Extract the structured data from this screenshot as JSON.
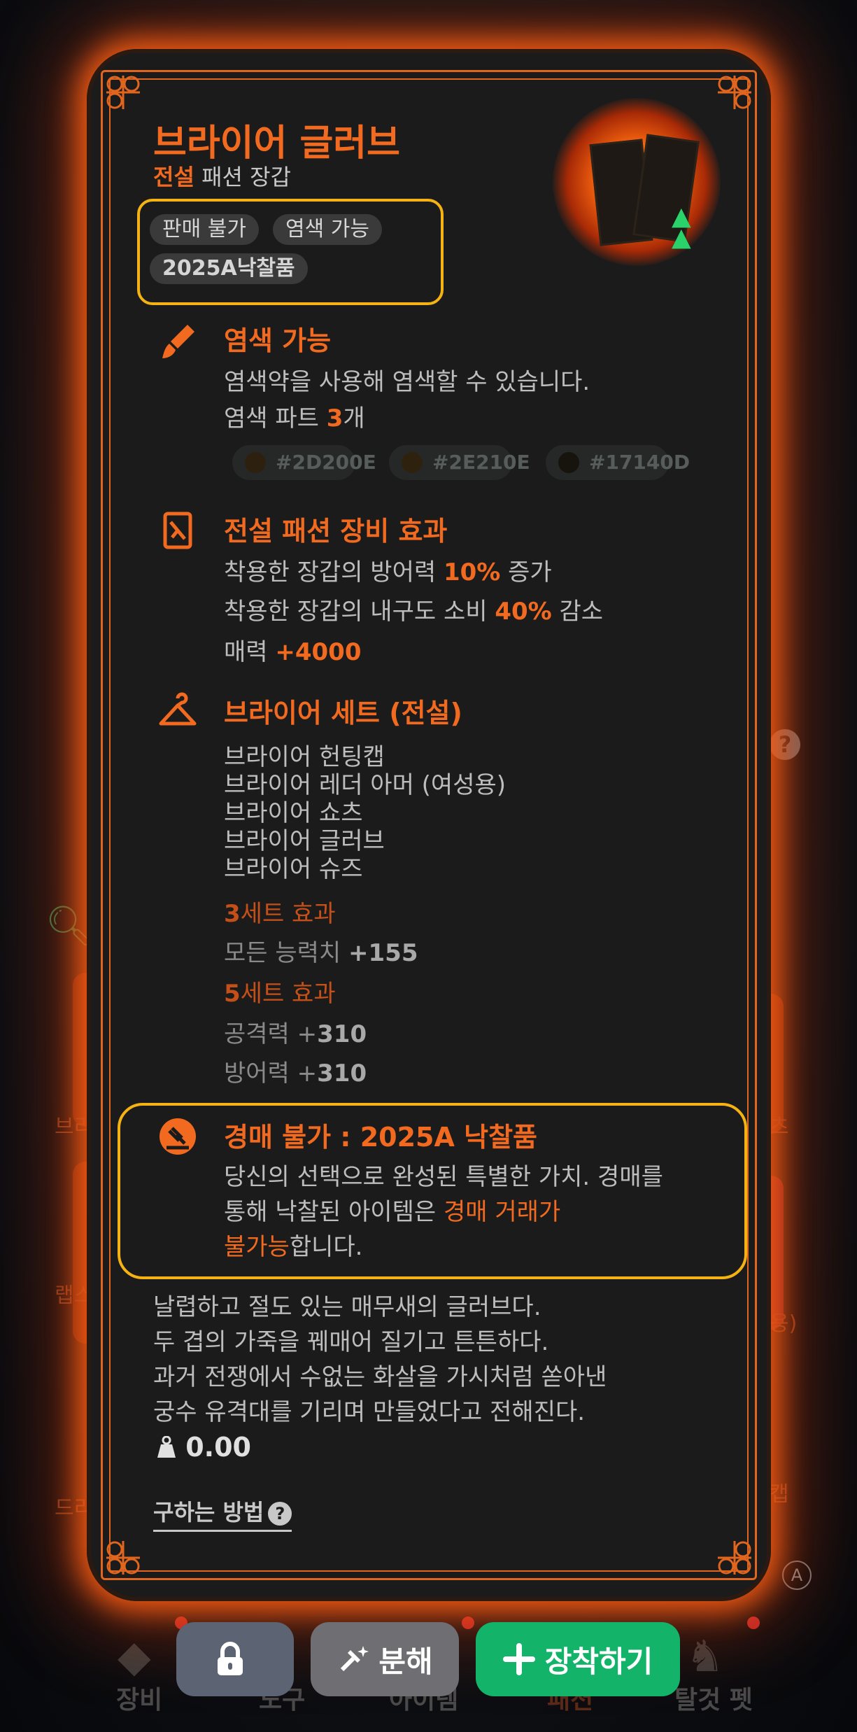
{
  "item": {
    "name": "브라이어 글러브",
    "grade": "전설",
    "category": "패션 장갑",
    "tags": [
      "판매 불가",
      "염색 가능",
      "2025A낙찰품"
    ]
  },
  "dye": {
    "title": "염색 가능",
    "desc": "염색약을 사용해 염색할 수 있습니다.",
    "parts_prefix": "염색 파트 ",
    "parts_count": "3",
    "parts_suffix": "개",
    "colors": [
      {
        "label": "#2D200E",
        "color": "#2D200E"
      },
      {
        "label": "#2E210E",
        "color": "#2E210E"
      },
      {
        "label": "#17140D",
        "color": "#17140D"
      }
    ]
  },
  "effects": {
    "title": "전설 패션 장비 효과",
    "l1_pre": "착용한 장갑의 방어력 ",
    "l1_val": "10%",
    "l1_post": " 증가",
    "l2_pre": "착용한 장갑의 내구도 소비 ",
    "l2_val": "40%",
    "l2_post": " 감소",
    "l3_pre": "매력 ",
    "l3_val": "+4000"
  },
  "set": {
    "title": "브라이어 세트 (전설)",
    "items": [
      "브라이어 헌팅캡",
      "브라이어 레더 아머 (여성용)",
      "브라이어 쇼츠",
      "브라이어 글러브",
      "브라이어 슈즈"
    ],
    "b3_num": "3",
    "b3_label": "세트 효과",
    "b3_eff_pre": "모든 능력치 ",
    "b3_eff_val": "+155",
    "b5_num": "5",
    "b5_label": "세트 효과",
    "b5_eff1_pre": "공격력 +",
    "b5_eff1_val": "310",
    "b5_eff2_pre": "방어력 +",
    "b5_eff2_val": "310"
  },
  "auction": {
    "title": "경매 불가 : 2025A 낙찰품",
    "l1": "당신의 선택으로 완성된 특별한 가치. 경매를",
    "l2_pre": "통해 낙찰된 아이템은 ",
    "l2_hl": "경매 거래가",
    "l3_hl": "불가능",
    "l3_post": "합니다."
  },
  "description": [
    "날렵하고 절도 있는 매무새의 글러브다.",
    "두 겹의 가죽을 꿰매어 질기고 튼튼하다.",
    "과거 전쟁에서 수없는 화살을 가시처럼 쏟아낸",
    "궁수 유격대를 기리며 만들었다고 전해진다."
  ],
  "weight": "0.00",
  "howto_label": "구하는 방법",
  "buttons": {
    "disassemble": "분해",
    "equip": "장착하기"
  },
  "background": {
    "nav": [
      "장비",
      "도구",
      "아이템",
      "패션",
      "탈것 펫"
    ],
    "side_texts": [
      "브리",
      "츠",
      "랩스",
      "용)",
      "드리",
      "캡"
    ]
  },
  "colors": {
    "accent": "#F26A1F",
    "highlight_box": "#F5B313",
    "equip": "#13B46A"
  }
}
